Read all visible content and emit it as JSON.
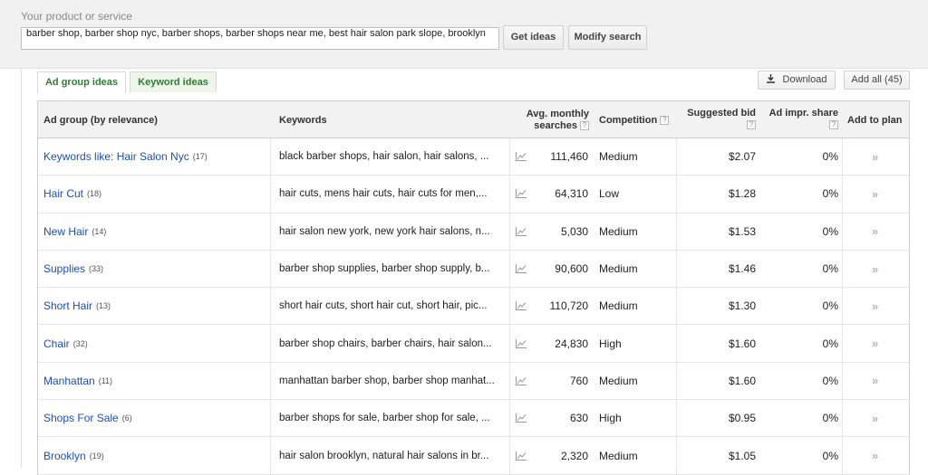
{
  "search": {
    "label": "Your product or service",
    "value": "barber shop, barber shop nyc, barber shops, barber shops near me, best hair salon park slope, brooklyn",
    "get_ideas": "Get ideas",
    "modify_search": "Modify search"
  },
  "tabs": [
    {
      "label": "Ad group ideas"
    },
    {
      "label": "Keyword ideas"
    }
  ],
  "actions": {
    "download": "Download",
    "add_all": "Add all (45)"
  },
  "columns": {
    "ad_group": "Ad group (by relevance)",
    "keywords": "Keywords",
    "avg_monthly_1": "Avg. monthly",
    "avg_monthly_2": "searches",
    "competition": "Competition",
    "suggested_bid": "Suggested bid",
    "ad_impr_share": "Ad impr. share",
    "add_to_plan": "Add to plan",
    "help": "?"
  },
  "rows": [
    {
      "group": "Keywords like: Hair Salon Nyc",
      "count": "(17)",
      "keywords": "black barber shops, hair salon, hair salons, ...",
      "searches": "111,460",
      "competition": "Medium",
      "bid": "$2.07",
      "share": "0%"
    },
    {
      "group": "Hair Cut",
      "count": "(18)",
      "keywords": "hair cuts, mens hair cuts, hair cuts for men,...",
      "searches": "64,310",
      "competition": "Low",
      "bid": "$1.28",
      "share": "0%"
    },
    {
      "group": "New Hair",
      "count": "(14)",
      "keywords": "hair salon new york, new york hair salons, n...",
      "searches": "5,030",
      "competition": "Medium",
      "bid": "$1.53",
      "share": "0%"
    },
    {
      "group": "Supplies",
      "count": "(33)",
      "keywords": "barber shop supplies, barber shop supply, b...",
      "searches": "90,600",
      "competition": "Medium",
      "bid": "$1.46",
      "share": "0%"
    },
    {
      "group": "Short Hair",
      "count": "(13)",
      "keywords": "short hair cuts, short hair cut, short hair, pic...",
      "searches": "110,720",
      "competition": "Medium",
      "bid": "$1.30",
      "share": "0%"
    },
    {
      "group": "Chair",
      "count": "(32)",
      "keywords": "barber shop chairs, barber chairs, hair salon...",
      "searches": "24,830",
      "competition": "High",
      "bid": "$1.60",
      "share": "0%"
    },
    {
      "group": "Manhattan",
      "count": "(11)",
      "keywords": "manhattan barber shop, barber shop manhat...",
      "searches": "760",
      "competition": "Medium",
      "bid": "$1.60",
      "share": "0%"
    },
    {
      "group": "Shops For Sale",
      "count": "(6)",
      "keywords": "barber shops for sale, barber shop for sale, ...",
      "searches": "630",
      "competition": "High",
      "bid": "$0.95",
      "share": "0%"
    },
    {
      "group": "Brooklyn",
      "count": "(19)",
      "keywords": "hair salon brooklyn, natural hair salons in br...",
      "searches": "2,320",
      "competition": "Medium",
      "bid": "$1.05",
      "share": "0%"
    }
  ],
  "icons": {
    "trend": "trend-chart-icon",
    "add": "double-chevron-icon",
    "download": "download-icon"
  },
  "colors": {
    "link": "#1a50b8",
    "tab_text": "#2e7d32",
    "header_bg": "#f2f2f2"
  }
}
